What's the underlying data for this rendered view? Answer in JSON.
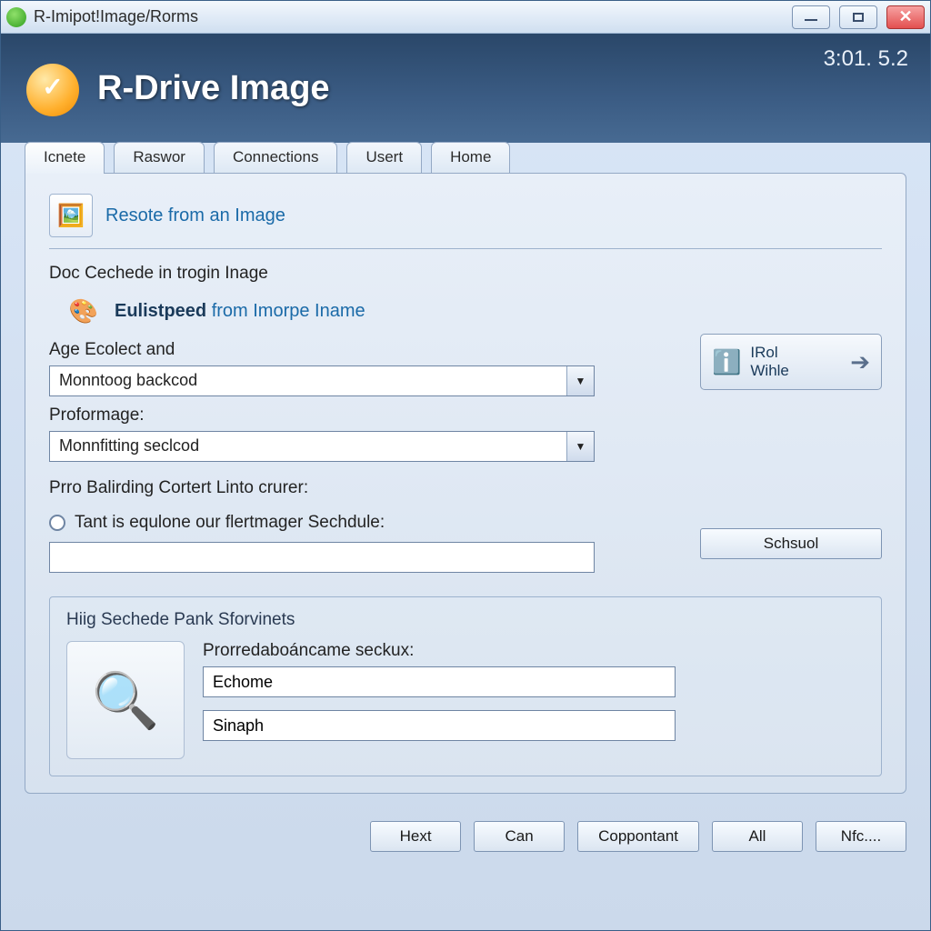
{
  "titlebar": {
    "title": "R-Imipot!Image/Rorms"
  },
  "banner": {
    "app_title": "R-Drive Image",
    "version": "3:01. 5.2"
  },
  "tabs": [
    {
      "label": "Icnete"
    },
    {
      "label": "Raswor"
    },
    {
      "label": "Connections"
    },
    {
      "label": "Usert"
    },
    {
      "label": "Home"
    }
  ],
  "panel": {
    "restore_link": "Resote from an Image",
    "subheading": "Doc Cechede in trogin Inage",
    "eulist_bold": "Eulistpeed",
    "eulist_rest": " from Imorpe Iname",
    "field1_label": "Age Ecolect and",
    "dropdown1_value": "Monntoog backcod",
    "field2_label": "Proformage:",
    "dropdown2_value": "Monnfitting seclcod",
    "section_label": "Prro Balirding Cortert Linto crurer:",
    "radio_label": "Tant is equlone our flertmager Sechdule:",
    "schedule_input": "",
    "schedule_btn": "Schsuol",
    "side_btn_line1": "IRol",
    "side_btn_line2": "Wihle",
    "group_title": "Hiig Sechede Pank Sforvinets",
    "group_field_label": "Prorredaboáncame seckux:",
    "group_input1": "Echome",
    "group_input2": "Sinaph"
  },
  "footer": {
    "b1": "Hext",
    "b2": "Can",
    "b3": "Coppontant",
    "b4": "All",
    "b5": "Nfc...."
  }
}
